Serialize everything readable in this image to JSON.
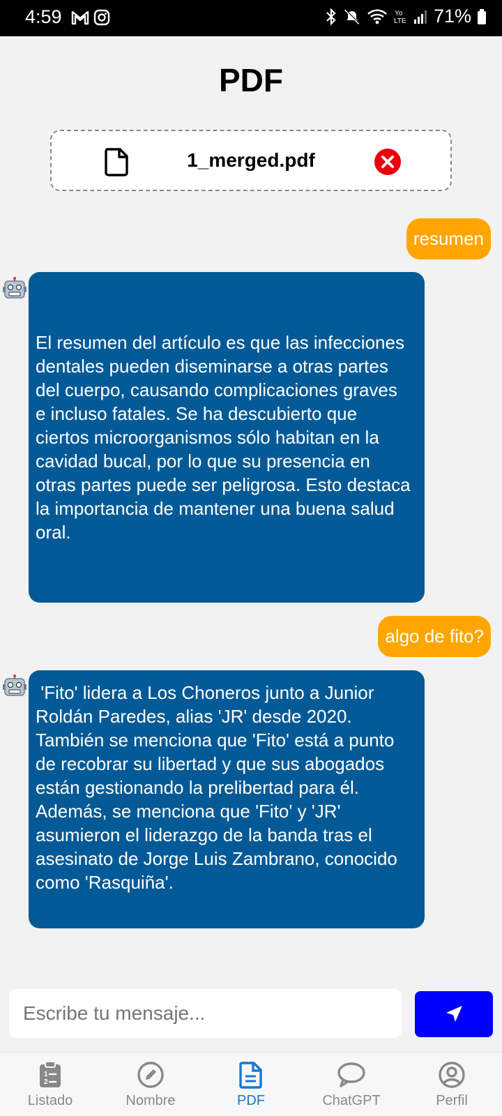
{
  "status": {
    "time": "4:59",
    "battery": "71%"
  },
  "header": {
    "title": "PDF"
  },
  "file": {
    "name": "1_merged.pdf"
  },
  "messages": [
    {
      "role": "user",
      "text": "resumen"
    },
    {
      "role": "bot",
      "text": "El resumen del artículo es que las infecciones dentales pueden diseminarse a otras partes del cuerpo, causando complicaciones graves e incluso fatales. Se ha descubierto que ciertos microorganismos sólo habitan en la cavidad bucal, por lo que su presencia en otras partes puede ser peligrosa. Esto destaca la importancia de mantener una buena salud oral."
    },
    {
      "role": "user",
      "text": "algo de fito?"
    },
    {
      "role": "bot",
      "text": " 'Fito' lidera a Los Choneros junto a Junior Roldán Paredes, alias 'JR' desde 2020. También se menciona que 'Fito' está a punto de recobrar su libertad y que sus abogados están gestionando la prelibertad para él. Además, se menciona que 'Fito' y 'JR' asumieron el liderazgo de la banda tras el asesinato de Jorge Luis Zambrano, conocido como 'Rasquiña'."
    }
  ],
  "composer": {
    "placeholder": "Escribe tu mensaje..."
  },
  "tabs": [
    {
      "label": "Listado",
      "icon": "clipboard-list-icon",
      "active": false
    },
    {
      "label": "Nombre",
      "icon": "pencil-circle-icon",
      "active": false
    },
    {
      "label": "PDF",
      "icon": "document-icon",
      "active": true
    },
    {
      "label": "ChatGPT",
      "icon": "chat-bubble-icon",
      "active": false
    },
    {
      "label": "Perfil",
      "icon": "user-circle-icon",
      "active": false
    }
  ],
  "colors": {
    "user_bubble": "#ffa500",
    "bot_bubble": "#045a96",
    "send_button": "#0000ff",
    "active_tab": "#1478d4",
    "remove_icon": "#e8000b"
  }
}
